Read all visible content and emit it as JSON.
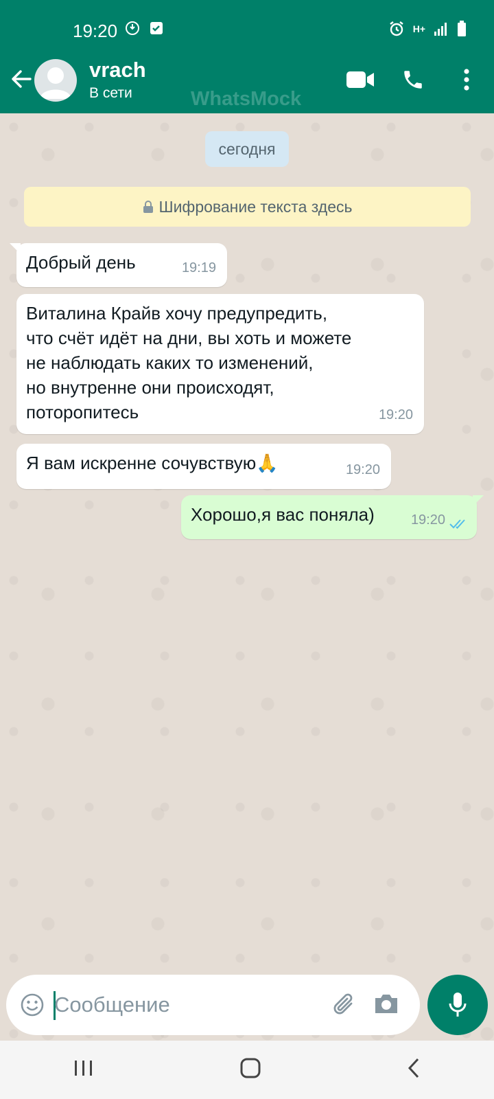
{
  "status_bar": {
    "time": "19:20",
    "network": "H+"
  },
  "header": {
    "contact_name": "vrach",
    "contact_status": "В сети",
    "watermark": "WhatsMock"
  },
  "chat": {
    "date_chip": "сегодня",
    "encryption_notice": "Шифрование текста здесь",
    "messages": [
      {
        "direction": "in",
        "text": "Добрый день",
        "time": "19:19"
      },
      {
        "direction": "in",
        "text": "Виталина Крайв хочу предупредить,\nчто счёт идёт на дни, вы хоть и можете\nне наблюдать каких то изменений,\nно внутренне они происходят,\nпоторопитесь",
        "time": "19:20"
      },
      {
        "direction": "in",
        "text": "Я вам искренне сочувствую🙏",
        "time": "19:20"
      },
      {
        "direction": "out",
        "text": "Хорошо,я вас поняла)",
        "time": "19:20",
        "read": true
      }
    ]
  },
  "composer": {
    "placeholder": "Сообщение"
  },
  "colors": {
    "header": "#008069",
    "chat_bg": "#e5ddd5",
    "outgoing_bubble": "#d9fdd3",
    "read_ticks": "#53bdeb"
  }
}
